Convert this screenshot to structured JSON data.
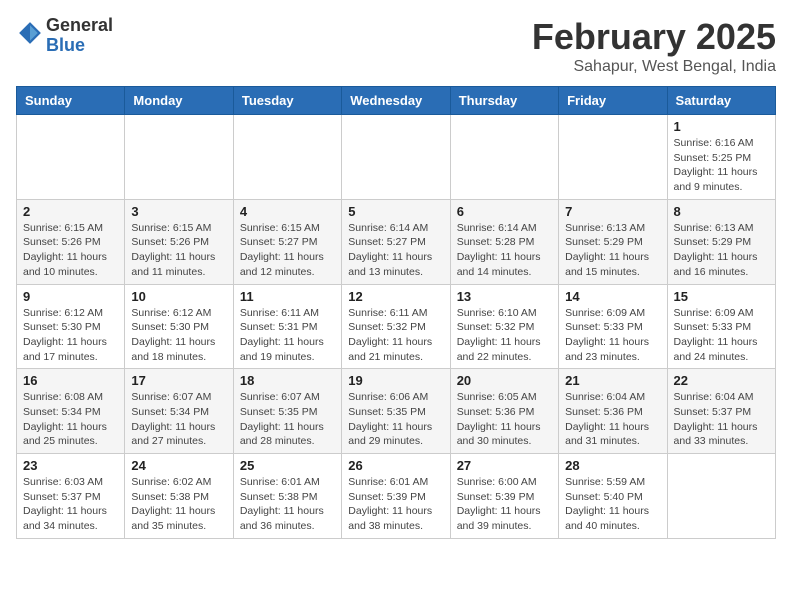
{
  "header": {
    "logo": {
      "general": "General",
      "blue": "Blue"
    },
    "title": "February 2025",
    "subtitle": "Sahapur, West Bengal, India"
  },
  "weekdays": [
    "Sunday",
    "Monday",
    "Tuesday",
    "Wednesday",
    "Thursday",
    "Friday",
    "Saturday"
  ],
  "weeks": [
    [
      {
        "day": "",
        "info": ""
      },
      {
        "day": "",
        "info": ""
      },
      {
        "day": "",
        "info": ""
      },
      {
        "day": "",
        "info": ""
      },
      {
        "day": "",
        "info": ""
      },
      {
        "day": "",
        "info": ""
      },
      {
        "day": "1",
        "info": "Sunrise: 6:16 AM\nSunset: 5:25 PM\nDaylight: 11 hours and 9 minutes."
      }
    ],
    [
      {
        "day": "2",
        "info": "Sunrise: 6:15 AM\nSunset: 5:26 PM\nDaylight: 11 hours and 10 minutes."
      },
      {
        "day": "3",
        "info": "Sunrise: 6:15 AM\nSunset: 5:26 PM\nDaylight: 11 hours and 11 minutes."
      },
      {
        "day": "4",
        "info": "Sunrise: 6:15 AM\nSunset: 5:27 PM\nDaylight: 11 hours and 12 minutes."
      },
      {
        "day": "5",
        "info": "Sunrise: 6:14 AM\nSunset: 5:27 PM\nDaylight: 11 hours and 13 minutes."
      },
      {
        "day": "6",
        "info": "Sunrise: 6:14 AM\nSunset: 5:28 PM\nDaylight: 11 hours and 14 minutes."
      },
      {
        "day": "7",
        "info": "Sunrise: 6:13 AM\nSunset: 5:29 PM\nDaylight: 11 hours and 15 minutes."
      },
      {
        "day": "8",
        "info": "Sunrise: 6:13 AM\nSunset: 5:29 PM\nDaylight: 11 hours and 16 minutes."
      }
    ],
    [
      {
        "day": "9",
        "info": "Sunrise: 6:12 AM\nSunset: 5:30 PM\nDaylight: 11 hours and 17 minutes."
      },
      {
        "day": "10",
        "info": "Sunrise: 6:12 AM\nSunset: 5:30 PM\nDaylight: 11 hours and 18 minutes."
      },
      {
        "day": "11",
        "info": "Sunrise: 6:11 AM\nSunset: 5:31 PM\nDaylight: 11 hours and 19 minutes."
      },
      {
        "day": "12",
        "info": "Sunrise: 6:11 AM\nSunset: 5:32 PM\nDaylight: 11 hours and 21 minutes."
      },
      {
        "day": "13",
        "info": "Sunrise: 6:10 AM\nSunset: 5:32 PM\nDaylight: 11 hours and 22 minutes."
      },
      {
        "day": "14",
        "info": "Sunrise: 6:09 AM\nSunset: 5:33 PM\nDaylight: 11 hours and 23 minutes."
      },
      {
        "day": "15",
        "info": "Sunrise: 6:09 AM\nSunset: 5:33 PM\nDaylight: 11 hours and 24 minutes."
      }
    ],
    [
      {
        "day": "16",
        "info": "Sunrise: 6:08 AM\nSunset: 5:34 PM\nDaylight: 11 hours and 25 minutes."
      },
      {
        "day": "17",
        "info": "Sunrise: 6:07 AM\nSunset: 5:34 PM\nDaylight: 11 hours and 27 minutes."
      },
      {
        "day": "18",
        "info": "Sunrise: 6:07 AM\nSunset: 5:35 PM\nDaylight: 11 hours and 28 minutes."
      },
      {
        "day": "19",
        "info": "Sunrise: 6:06 AM\nSunset: 5:35 PM\nDaylight: 11 hours and 29 minutes."
      },
      {
        "day": "20",
        "info": "Sunrise: 6:05 AM\nSunset: 5:36 PM\nDaylight: 11 hours and 30 minutes."
      },
      {
        "day": "21",
        "info": "Sunrise: 6:04 AM\nSunset: 5:36 PM\nDaylight: 11 hours and 31 minutes."
      },
      {
        "day": "22",
        "info": "Sunrise: 6:04 AM\nSunset: 5:37 PM\nDaylight: 11 hours and 33 minutes."
      }
    ],
    [
      {
        "day": "23",
        "info": "Sunrise: 6:03 AM\nSunset: 5:37 PM\nDaylight: 11 hours and 34 minutes."
      },
      {
        "day": "24",
        "info": "Sunrise: 6:02 AM\nSunset: 5:38 PM\nDaylight: 11 hours and 35 minutes."
      },
      {
        "day": "25",
        "info": "Sunrise: 6:01 AM\nSunset: 5:38 PM\nDaylight: 11 hours and 36 minutes."
      },
      {
        "day": "26",
        "info": "Sunrise: 6:01 AM\nSunset: 5:39 PM\nDaylight: 11 hours and 38 minutes."
      },
      {
        "day": "27",
        "info": "Sunrise: 6:00 AM\nSunset: 5:39 PM\nDaylight: 11 hours and 39 minutes."
      },
      {
        "day": "28",
        "info": "Sunrise: 5:59 AM\nSunset: 5:40 PM\nDaylight: 11 hours and 40 minutes."
      },
      {
        "day": "",
        "info": ""
      }
    ]
  ]
}
